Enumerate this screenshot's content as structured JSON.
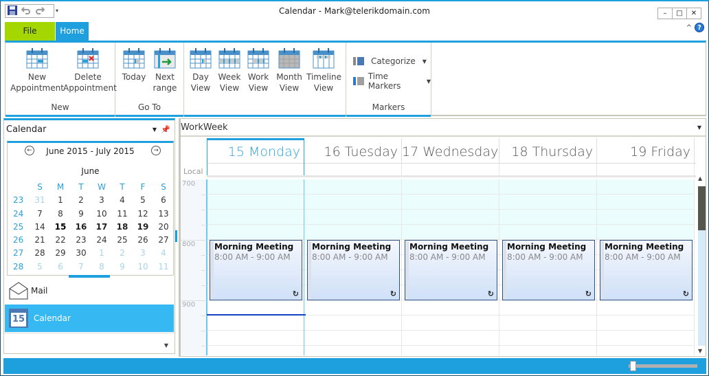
{
  "window": {
    "title": "Calendar - Mark@telerikdomain.com",
    "controls": {
      "minimize": "–",
      "maximize": "□",
      "close": "✕"
    },
    "help_label": "?",
    "collapse_label": "^"
  },
  "qat": {
    "items": [
      "save-icon",
      "undo-icon",
      "redo-icon"
    ],
    "dropdown": "▾"
  },
  "tabs": [
    {
      "label": "File",
      "color": "#a4d600"
    },
    {
      "label": "Home",
      "color": "#1ea0de",
      "active": true
    }
  ],
  "ribbon": {
    "groups": [
      {
        "label": "New",
        "buttons": [
          {
            "line1": "New",
            "line2": "Appointment",
            "icon": "new-appointment-icon"
          },
          {
            "line1": "Delete",
            "line2": "Appointment",
            "icon": "delete-appointment-icon"
          }
        ]
      },
      {
        "label": "Go To",
        "buttons": [
          {
            "line1": "Today",
            "line2": "",
            "icon": "today-icon"
          },
          {
            "line1": "Next",
            "line2": "range",
            "icon": "next-range-icon"
          }
        ]
      },
      {
        "label": "",
        "buttons": [
          {
            "line1": "Day",
            "line2": "View",
            "icon": "day-view-icon"
          },
          {
            "line1": "Week",
            "line2": "View",
            "icon": "week-view-icon"
          },
          {
            "line1": "Work",
            "line2": "View",
            "icon": "work-view-icon"
          },
          {
            "line1": "Month",
            "line2": "View",
            "icon": "month-view-icon"
          },
          {
            "line1": "Timeline",
            "line2": "View",
            "icon": "timeline-view-icon"
          }
        ]
      },
      {
        "label": "Markers",
        "items": [
          {
            "label": "Categorize",
            "color": "#4a7ab3"
          },
          {
            "label": "Time Markers",
            "color": "#a0a0a0"
          }
        ]
      }
    ]
  },
  "left_pane": {
    "header": "Calendar",
    "mini_calendar": {
      "range": "June 2015 - July 2015",
      "month": "June",
      "days_of_week": [
        "S",
        "M",
        "T",
        "W",
        "T",
        "F",
        "S"
      ],
      "weeks": [
        {
          "wk": "23",
          "days": [
            [
              "31",
              "o"
            ],
            [
              "1",
              "c"
            ],
            [
              "2",
              "c"
            ],
            [
              "3",
              "c"
            ],
            [
              "4",
              "c"
            ],
            [
              "5",
              "c"
            ],
            [
              "6",
              "c"
            ]
          ]
        },
        {
          "wk": "24",
          "days": [
            [
              "7",
              "c"
            ],
            [
              "8",
              "c"
            ],
            [
              "9",
              "c"
            ],
            [
              "10",
              "c"
            ],
            [
              "11",
              "c"
            ],
            [
              "12",
              "c"
            ],
            [
              "13",
              "c"
            ]
          ]
        },
        {
          "wk": "25",
          "days": [
            [
              "14",
              "c"
            ],
            [
              "15",
              "t"
            ],
            [
              "16",
              "b"
            ],
            [
              "17",
              "b"
            ],
            [
              "18",
              "b"
            ],
            [
              "19",
              "b"
            ],
            [
              "20",
              "c"
            ]
          ]
        },
        {
          "wk": "26",
          "days": [
            [
              "21",
              "c"
            ],
            [
              "22",
              "c"
            ],
            [
              "23",
              "c"
            ],
            [
              "24",
              "c"
            ],
            [
              "25",
              "c"
            ],
            [
              "26",
              "c"
            ],
            [
              "27",
              "c"
            ]
          ]
        },
        {
          "wk": "27",
          "days": [
            [
              "28",
              "c"
            ],
            [
              "29",
              "c"
            ],
            [
              "30",
              "c"
            ],
            [
              "1",
              "o"
            ],
            [
              "2",
              "o"
            ],
            [
              "3",
              "o"
            ],
            [
              "4",
              "o"
            ]
          ]
        },
        {
          "wk": "28",
          "days": [
            [
              "5",
              "o"
            ],
            [
              "6",
              "o"
            ],
            [
              "7",
              "o"
            ],
            [
              "8",
              "o"
            ],
            [
              "9",
              "o"
            ],
            [
              "10",
              "o"
            ],
            [
              "11",
              "o"
            ]
          ]
        }
      ]
    },
    "nav": [
      {
        "label": "Mail",
        "icon": "mail-icon"
      },
      {
        "label": "Calendar",
        "icon": "calendar-icon",
        "icon_text": "15",
        "selected": true
      }
    ]
  },
  "scheduler": {
    "view_name": "WorkWeek",
    "timezone_label": "Local",
    "days": [
      {
        "label": "15 Monday",
        "today": true
      },
      {
        "label": "16 Tuesday"
      },
      {
        "label": "17 Wednesday"
      },
      {
        "label": "18 Thursday"
      },
      {
        "label": "19 Friday"
      }
    ],
    "hours": [
      "700",
      "800",
      "900"
    ],
    "appointments": [
      {
        "day": 0,
        "subject": "Morning Meeting",
        "time": "8:00 AM - 9:00 AM",
        "recurring": true
      },
      {
        "day": 1,
        "subject": "Morning Meeting",
        "time": "8:00 AM - 9:00 AM",
        "recurring": true
      },
      {
        "day": 2,
        "subject": "Morning Meeting",
        "time": "8:00 AM - 9:00 AM",
        "recurring": true
      },
      {
        "day": 3,
        "subject": "Morning Meeting",
        "time": "8:00 AM - 9:00 AM",
        "recurring": true
      },
      {
        "day": 4,
        "subject": "Morning Meeting",
        "time": "8:00 AM - 9:00 AM",
        "recurring": true
      }
    ],
    "recurrence_glyph": "↻"
  },
  "status_bar": {
    "zoom_level": 0.05
  },
  "colors": {
    "accent": "#1ea0de",
    "file_tab": "#a4d600",
    "selected_nav": "#36b9f2"
  }
}
